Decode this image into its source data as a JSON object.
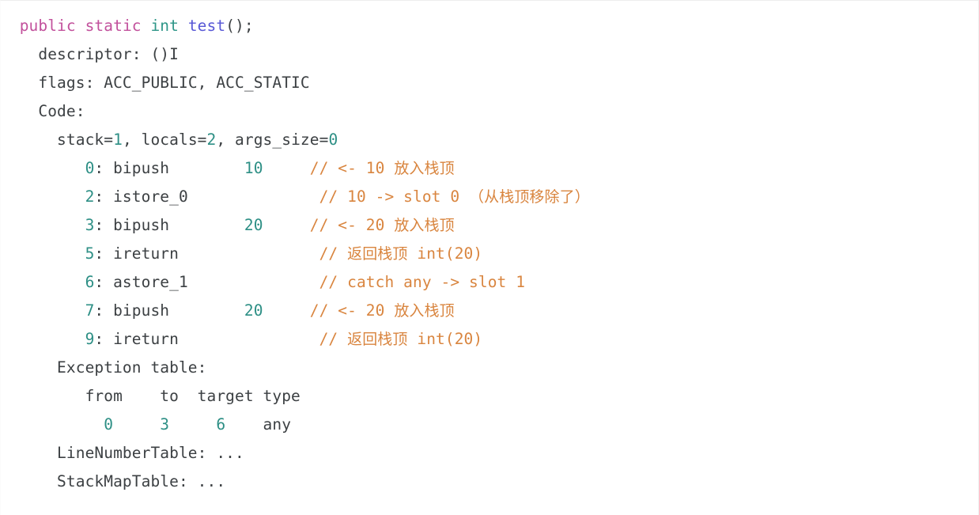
{
  "panel": {
    "title": "javap bytecode output",
    "background_color": "#ffffff",
    "border_color": "#ededed"
  },
  "palette": {
    "plain": "#3c4043",
    "keyword": "#c2519c",
    "type": "#2e9688",
    "function": "#5757d6",
    "number": "#2d8f85",
    "comment": "#d9853f"
  },
  "code": {
    "language": "java-bytecode",
    "lines": [
      {
        "id": "line-1",
        "indent": "  ",
        "tokens": [
          {
            "kind": "keyword",
            "text": "public"
          },
          {
            "kind": "plain",
            "text": " "
          },
          {
            "kind": "keyword",
            "text": "static"
          },
          {
            "kind": "plain",
            "text": " "
          },
          {
            "kind": "type",
            "text": "int"
          },
          {
            "kind": "plain",
            "text": " "
          },
          {
            "kind": "function",
            "text": "test"
          },
          {
            "kind": "plain",
            "text": "();"
          }
        ]
      },
      {
        "id": "line-2",
        "indent": "    ",
        "tokens": [
          {
            "kind": "plain",
            "text": "descriptor: ()I"
          }
        ]
      },
      {
        "id": "line-3",
        "indent": "    ",
        "tokens": [
          {
            "kind": "plain",
            "text": "flags: ACC_PUBLIC, ACC_STATIC"
          }
        ]
      },
      {
        "id": "line-4",
        "indent": "    ",
        "tokens": [
          {
            "kind": "plain",
            "text": "Code:"
          }
        ]
      },
      {
        "id": "line-5",
        "indent": "      ",
        "tokens": [
          {
            "kind": "plain",
            "text": "stack="
          },
          {
            "kind": "number",
            "text": "1"
          },
          {
            "kind": "plain",
            "text": ", locals="
          },
          {
            "kind": "number",
            "text": "2"
          },
          {
            "kind": "plain",
            "text": ", args_size="
          },
          {
            "kind": "number",
            "text": "0"
          }
        ]
      },
      {
        "id": "line-6",
        "indent": "         ",
        "tokens": [
          {
            "kind": "number",
            "text": "0"
          },
          {
            "kind": "plain",
            "text": ": bipush        "
          },
          {
            "kind": "number",
            "text": "10"
          },
          {
            "kind": "plain",
            "text": "     "
          },
          {
            "kind": "comment",
            "text": "// <- 10 "
          },
          {
            "kind": "comment-cjk",
            "text": "放入栈顶"
          }
        ]
      },
      {
        "id": "line-7",
        "indent": "         ",
        "tokens": [
          {
            "kind": "number",
            "text": "2"
          },
          {
            "kind": "plain",
            "text": ": istore_0"
          },
          {
            "kind": "plain",
            "text": "              "
          },
          {
            "kind": "comment",
            "text": "// 10 -> slot 0 "
          },
          {
            "kind": "comment-cjk",
            "text": "（从栈顶移除了）"
          }
        ]
      },
      {
        "id": "line-8",
        "indent": "         ",
        "tokens": [
          {
            "kind": "number",
            "text": "3"
          },
          {
            "kind": "plain",
            "text": ": bipush        "
          },
          {
            "kind": "number",
            "text": "20"
          },
          {
            "kind": "plain",
            "text": "     "
          },
          {
            "kind": "comment",
            "text": "// <- 20 "
          },
          {
            "kind": "comment-cjk",
            "text": "放入栈顶"
          }
        ]
      },
      {
        "id": "line-9",
        "indent": "         ",
        "tokens": [
          {
            "kind": "number",
            "text": "5"
          },
          {
            "kind": "plain",
            "text": ": ireturn"
          },
          {
            "kind": "plain",
            "text": "               "
          },
          {
            "kind": "comment",
            "text": "// "
          },
          {
            "kind": "comment-cjk",
            "text": "返回栈顶"
          },
          {
            "kind": "comment",
            "text": " int(20)"
          }
        ]
      },
      {
        "id": "line-10",
        "indent": "         ",
        "tokens": [
          {
            "kind": "number",
            "text": "6"
          },
          {
            "kind": "plain",
            "text": ": astore_1"
          },
          {
            "kind": "plain",
            "text": "              "
          },
          {
            "kind": "comment",
            "text": "// catch any -> slot 1"
          }
        ]
      },
      {
        "id": "line-11",
        "indent": "         ",
        "tokens": [
          {
            "kind": "number",
            "text": "7"
          },
          {
            "kind": "plain",
            "text": ": bipush        "
          },
          {
            "kind": "number",
            "text": "20"
          },
          {
            "kind": "plain",
            "text": "     "
          },
          {
            "kind": "comment",
            "text": "// <- 20 "
          },
          {
            "kind": "comment-cjk",
            "text": "放入栈顶"
          }
        ]
      },
      {
        "id": "line-12",
        "indent": "         ",
        "tokens": [
          {
            "kind": "number",
            "text": "9"
          },
          {
            "kind": "plain",
            "text": ": ireturn"
          },
          {
            "kind": "plain",
            "text": "               "
          },
          {
            "kind": "comment",
            "text": "// "
          },
          {
            "kind": "comment-cjk",
            "text": "返回栈顶"
          },
          {
            "kind": "comment",
            "text": " int(20)"
          }
        ]
      },
      {
        "id": "line-13",
        "indent": "      ",
        "tokens": [
          {
            "kind": "plain",
            "text": "Exception table:"
          }
        ]
      },
      {
        "id": "line-14",
        "indent": "         ",
        "tokens": [
          {
            "kind": "plain",
            "text": "from    to  target type"
          }
        ]
      },
      {
        "id": "line-15",
        "indent": "           ",
        "tokens": [
          {
            "kind": "number",
            "text": "0"
          },
          {
            "kind": "plain",
            "text": "     "
          },
          {
            "kind": "number",
            "text": "3"
          },
          {
            "kind": "plain",
            "text": "     "
          },
          {
            "kind": "number",
            "text": "6"
          },
          {
            "kind": "plain",
            "text": "    any"
          }
        ]
      },
      {
        "id": "line-16",
        "indent": "      ",
        "tokens": [
          {
            "kind": "plain",
            "text": "LineNumberTable: ..."
          }
        ]
      },
      {
        "id": "line-17",
        "indent": "      ",
        "tokens": [
          {
            "kind": "plain",
            "text": "StackMapTable: ..."
          }
        ]
      }
    ]
  }
}
